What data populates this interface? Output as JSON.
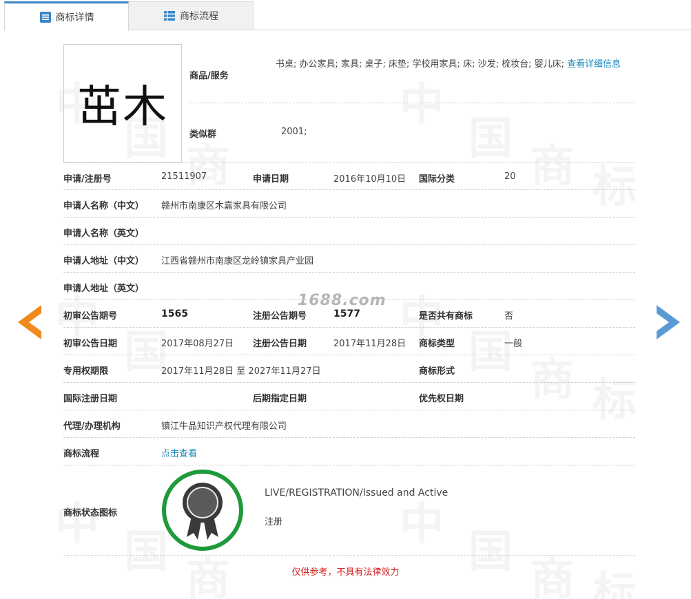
{
  "tabs": [
    {
      "label": "商标详情",
      "active": true
    },
    {
      "label": "商标流程",
      "active": false
    }
  ],
  "mark": {
    "text": "茁木"
  },
  "goods": {
    "label": "商品/服务",
    "text": "书桌; 办公家具; 家具; 桌子; 床垫; 学校用家具; 床; 沙发; 梳妆台; 婴儿床;",
    "link": "查看详细信息"
  },
  "similar": {
    "label": "类似群",
    "value": "2001;"
  },
  "rows": {
    "reg_no_label": "申请/注册号",
    "reg_no": "21511907",
    "apply_date_label": "申请日期",
    "apply_date": "2016年10月10日",
    "intl_class_label": "国际分类",
    "intl_class": "20",
    "applicant_cn_label": "申请人名称（中文）",
    "applicant_cn": "赣州市南康区木嘉家具有限公司",
    "applicant_en_label": "申请人名称（英文）",
    "applicant_en": "",
    "address_cn_label": "申请人地址（中文）",
    "address_cn": "江西省赣州市南康区龙岭镇家具产业园",
    "address_en_label": "申请人地址（英文）",
    "address_en": "",
    "prelim_no_label": "初审公告期号",
    "prelim_no": "1565",
    "reg_pub_no_label": "注册公告期号",
    "reg_pub_no": "1577",
    "shared_label": "是否共有商标",
    "shared": "否",
    "prelim_date_label": "初审公告日期",
    "prelim_date": "2017年08月27日",
    "reg_pub_date_label": "注册公告日期",
    "reg_pub_date": "2017年11月28日",
    "mark_type_label": "商标类型",
    "mark_type": "一般",
    "exclusive_label": "专用权期限",
    "exclusive": "2017年11月28日 至 2027年11月27日",
    "mark_form_label": "商标形式",
    "mark_form": "",
    "intl_reg_date_label": "国际注册日期",
    "intl_reg_date": "",
    "later_date_label": "后期指定日期",
    "later_date": "",
    "priority_label": "优先权日期",
    "priority": "",
    "agent_label": "代理/办理机构",
    "agent": "镇江牛品知识产权代理有限公司",
    "flow_label": "商标流程",
    "flow_link": "点击查看"
  },
  "status": {
    "label": "商标状态图标",
    "en": "LIVE/REGISTRATION/Issued and Active",
    "cn": "注册",
    "ring_color": "#1e9a3a"
  },
  "site_watermark": "1688.com",
  "disclaimer": "仅供参考，不具有法律效力",
  "colors": {
    "accent": "#3a86c8",
    "link": "#1a8bb8",
    "prev_arrow": "#f08a1c",
    "next_arrow": "#5b9bd5",
    "disclaimer": "#d62020"
  }
}
